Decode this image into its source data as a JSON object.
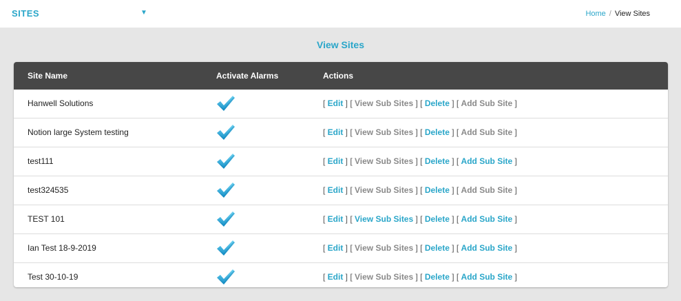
{
  "header": {
    "section": "SITES",
    "caret": "▼",
    "breadcrumb": {
      "home": "Home",
      "sep": "/",
      "current": "View Sites"
    }
  },
  "page_title": "View Sites",
  "table": {
    "columns": [
      "Site Name",
      "Activate Alarms",
      "Actions"
    ],
    "action_labels": {
      "edit": "Edit",
      "view": "View Sub Sites",
      "delete": "Delete",
      "add": "Add Sub Site"
    },
    "rows": [
      {
        "name": "Hanwell Solutions",
        "alarm": true,
        "view_enabled": false,
        "add_enabled": false
      },
      {
        "name": "Notion large System testing",
        "alarm": true,
        "view_enabled": false,
        "add_enabled": false
      },
      {
        "name": "test111",
        "alarm": true,
        "view_enabled": false,
        "add_enabled": true
      },
      {
        "name": "test324535",
        "alarm": true,
        "view_enabled": false,
        "add_enabled": false
      },
      {
        "name": "TEST 101",
        "alarm": true,
        "view_enabled": true,
        "add_enabled": true
      },
      {
        "name": "Ian Test 18-9-2019",
        "alarm": true,
        "view_enabled": false,
        "add_enabled": true
      },
      {
        "name": "Test 30-10-19",
        "alarm": true,
        "view_enabled": false,
        "add_enabled": true
      }
    ]
  },
  "colors": {
    "accent": "#2aa6c9",
    "header_bg": "#474747",
    "disabled": "#8a8a8a",
    "check": "#1fa3d6"
  },
  "icons": {
    "alarm": "checkmark-icon"
  }
}
